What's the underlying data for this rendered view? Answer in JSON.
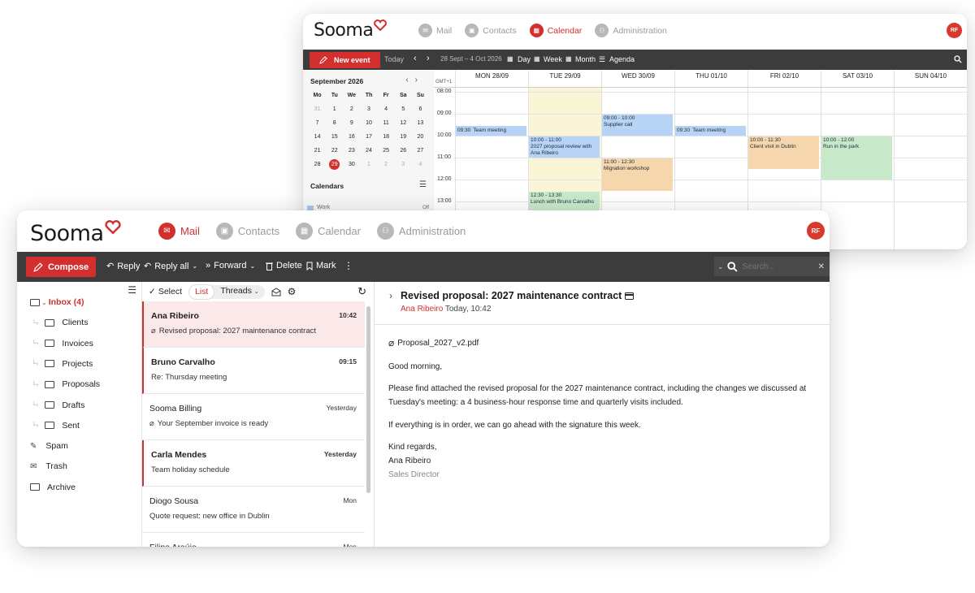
{
  "calendar_window": {
    "logo": "Sooma",
    "nav": [
      {
        "label": "Mail",
        "icon": "mail-icon",
        "active": false
      },
      {
        "label": "Contacts",
        "icon": "contacts-icon",
        "active": false
      },
      {
        "label": "Calendar",
        "icon": "calendar-icon",
        "active": true
      },
      {
        "label": "Administration",
        "icon": "administration-icon",
        "active": false
      }
    ],
    "avatar": "RF",
    "toolbar": {
      "new_event": "New event",
      "today": "Today",
      "range": "28 Sept – 4 Oct 2026",
      "views": [
        "Day",
        "Week",
        "Month",
        "Agenda"
      ]
    },
    "mini_calendar": {
      "title": "September 2026",
      "weekdays": [
        "Mo",
        "Tu",
        "We",
        "Th",
        "Fr",
        "Sa",
        "Su"
      ],
      "days": [
        "31",
        "1",
        "2",
        "3",
        "4",
        "5",
        "6",
        "7",
        "8",
        "9",
        "10",
        "11",
        "12",
        "13",
        "14",
        "15",
        "16",
        "17",
        "18",
        "19",
        "20",
        "21",
        "22",
        "23",
        "24",
        "25",
        "26",
        "27",
        "28",
        "29",
        "30",
        "1",
        "2",
        "3",
        "4"
      ],
      "dim_days": [
        0,
        31,
        32,
        33,
        34
      ],
      "today_index": 29
    },
    "calendars_title": "Calendars",
    "calendar_item": {
      "label": "Work",
      "state": "Off"
    },
    "timezone": "GMT+1",
    "day_headers": [
      "MON 28/09",
      "TUE 29/09",
      "WED 30/09",
      "THU 01/10",
      "FRI 02/10",
      "SAT 03/10",
      "SUN 04/10"
    ],
    "hours": [
      "08:00",
      "09:00",
      "10:00",
      "11:00",
      "12:00",
      "13:00"
    ],
    "events": [
      {
        "day": 0,
        "time": "09:30",
        "title": "Team meeting",
        "color": "blue"
      },
      {
        "day": 1,
        "time": "10:00 - 11:00",
        "title": "2027 proposal review with Ana Ribeiro",
        "color": "blue"
      },
      {
        "day": 1,
        "time": "12:30 - 13:30",
        "title": "Lunch with Bruno Carvalho",
        "color": "green"
      },
      {
        "day": 2,
        "time": "09:00 - 10:00",
        "title": "Supplier call",
        "color": "blue"
      },
      {
        "day": 2,
        "time": "11:00 - 12:30",
        "title": "Migration workshop",
        "color": "orange"
      },
      {
        "day": 3,
        "time": "09:30",
        "title": "Team meeting",
        "color": "blue"
      },
      {
        "day": 4,
        "time": "10:00 - 11:30",
        "title": "Client visit in Dublin",
        "color": "orange"
      },
      {
        "day": 5,
        "time": "10:00 - 12:00",
        "title": "Run in the park",
        "color": "green"
      }
    ]
  },
  "mail_window": {
    "logo": "Sooma",
    "nav": [
      {
        "label": "Mail",
        "icon": "mail-icon",
        "active": true
      },
      {
        "label": "Contacts",
        "icon": "contacts-icon",
        "active": false
      },
      {
        "label": "Calendar",
        "icon": "calendar-icon",
        "active": false
      },
      {
        "label": "Administration",
        "icon": "administration-icon",
        "active": false
      }
    ],
    "avatar": "RF",
    "toolbar": {
      "compose": "Compose",
      "reply": "Reply",
      "reply_all": "Reply all",
      "forward": "Forward",
      "delete": "Delete",
      "mark": "Mark",
      "search_placeholder": "Search..."
    },
    "folders": [
      {
        "label": "Inbox (4)",
        "icon": "inbox-icon",
        "active": true,
        "child": false
      },
      {
        "label": "Clients",
        "icon": "folder-icon",
        "child": true
      },
      {
        "label": "Invoices",
        "icon": "folder-icon",
        "child": true
      },
      {
        "label": "Projects",
        "icon": "folder-icon",
        "child": true
      },
      {
        "label": "Proposals",
        "icon": "folder-icon",
        "child": true
      },
      {
        "label": "Drafts",
        "icon": "folder-icon",
        "child": true
      },
      {
        "label": "Sent",
        "icon": "folder-icon",
        "child": true
      },
      {
        "label": "Spam",
        "icon": "spam-icon",
        "child": false
      },
      {
        "label": "Trash",
        "icon": "trash-icon",
        "child": false
      },
      {
        "label": "Archive",
        "icon": "archive-icon",
        "child": false
      }
    ],
    "list_header": {
      "select": "Select",
      "list": "List",
      "threads": "Threads"
    },
    "messages": [
      {
        "from": "Ana Ribeiro",
        "time": "10:42",
        "subject": "Revised proposal: 2027 maintenance contract",
        "attachment": true,
        "unread": true,
        "selected": true
      },
      {
        "from": "Bruno Carvalho",
        "time": "09:15",
        "subject": "Re: Thursday meeting",
        "attachment": false,
        "unread": true,
        "selected": false
      },
      {
        "from": "Sooma Billing",
        "time": "Yesterday",
        "subject": "Your September invoice is ready",
        "attachment": true,
        "unread": false,
        "selected": false
      },
      {
        "from": "Carla Mendes",
        "time": "Yesterday",
        "subject": "Team holiday schedule",
        "attachment": false,
        "unread": true,
        "selected": false
      },
      {
        "from": "Diogo Sousa",
        "time": "Mon",
        "subject": "Quote request: new office in Dublin",
        "attachment": false,
        "unread": false,
        "selected": false
      },
      {
        "from": "Filipa Araújo",
        "time": "Mon",
        "subject": "",
        "attachment": false,
        "unread": false,
        "selected": false
      }
    ],
    "reader": {
      "subject": "Revised proposal: 2027 maintenance contract",
      "sender": "Ana Ribeiro",
      "date": "Today, 10:42",
      "attachment": "Proposal_2027_v2.pdf",
      "greeting": "Good morning,",
      "body1": "Please find attached the revised proposal for the 2027 maintenance contract, including the changes we discussed at Tuesday's meeting: a 4 business-hour response time and quarterly visits included.",
      "body2": "If everything is in order, we can go ahead with the signature this week.",
      "closing": "Kind regards,",
      "signature_name": "Ana Ribeiro",
      "signature_title": "Sales Director"
    }
  },
  "colors": {
    "accent": "#d32f2f",
    "toolbar": "#3c3c3c",
    "event_blue": "#b7d3f5",
    "event_orange": "#f6d6ac",
    "event_green": "#c8e9c9"
  }
}
